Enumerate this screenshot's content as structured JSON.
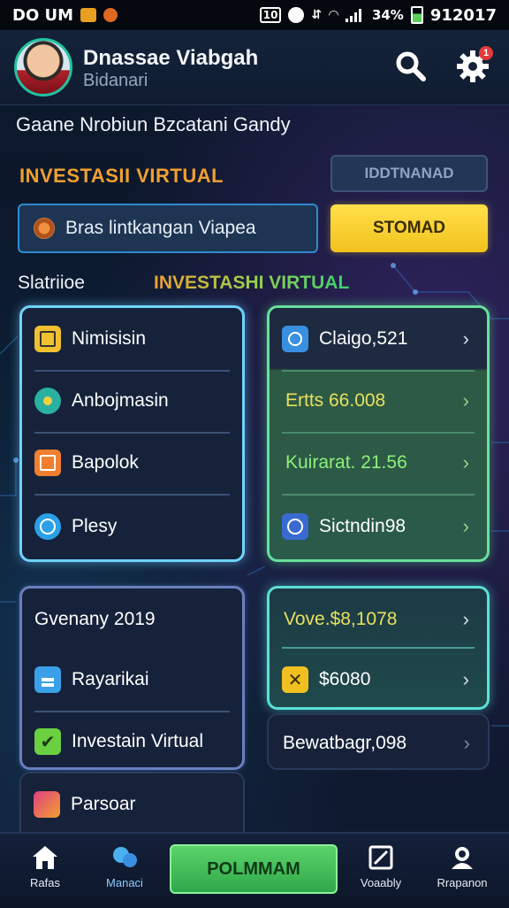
{
  "status_bar": {
    "left": "DO UM",
    "right": "912017",
    "battery": "34%"
  },
  "header": {
    "name": "Dnassae Viabgah",
    "sub": "Bidanari",
    "notif_count": "1"
  },
  "subtitle": "Gaane Nrobiun Bzcatani Gandy",
  "section": {
    "title": "INVESTASII VIRTUAL",
    "ghost_button": "IDDTNANAD"
  },
  "search": {
    "value": "Bras lintkangan Viapea"
  },
  "primary_button": "STOMAD",
  "row": {
    "left_label": "Slatriioe",
    "right_label": "INVESTASHI VIRTUAL"
  },
  "left_card1": [
    "Nimisisin",
    "Anbojmasin",
    "Bapolok",
    "Plesy"
  ],
  "right_card1": [
    "Claigo,521",
    "Ertts 66.008",
    "Kuirarat. 21.56",
    "Sictndin98"
  ],
  "left_card2": {
    "heading": "Gvenany 2019",
    "items": [
      "Rayarikai",
      "Investain Virtual"
    ]
  },
  "right_card2": [
    "Vove.$8,1078",
    "$6080"
  ],
  "right_card3": "Bewatbagr,098",
  "left_card3": "Parsoar",
  "nav": {
    "home": "Rafas",
    "second": "Manaci",
    "cta": "POLMMAM",
    "fourth": "Voaably",
    "fifth": "Rrapanon"
  },
  "colors": {
    "accent_orange": "#f0a030",
    "accent_green": "#69e09c",
    "accent_cyan": "#6fd3ff",
    "yellow": "#ffe04a"
  }
}
